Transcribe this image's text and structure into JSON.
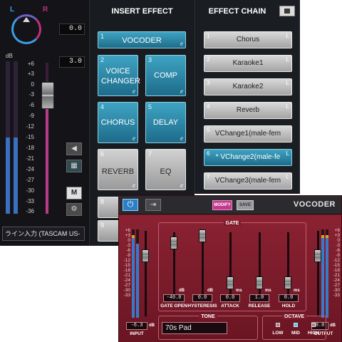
{
  "left": {
    "pan_left_label": "L",
    "pan_right_label": "R",
    "pan_value": "0.0",
    "fader_value": "3.0",
    "db_unit": "dB",
    "scale": [
      "+6",
      "+3",
      "0",
      "-3",
      "-6",
      "-9",
      "-12",
      "-15",
      "-18",
      "-21",
      "-24",
      "-27",
      "-30",
      "-33",
      "-36"
    ],
    "meter_left_level": 0.5,
    "meter_right_level": 0.5,
    "mute_button": "M",
    "input_name": "ライン入力 (TASCAM US-"
  },
  "insert_effect": {
    "title": "INSERT EFFECT",
    "slots": [
      {
        "num": "1",
        "label": "VOCODER",
        "edit": "e"
      },
      {
        "num": "2",
        "label": "VOICE CHANGER",
        "edit": "e"
      },
      {
        "num": "3",
        "label": "COMP",
        "edit": "e"
      },
      {
        "num": "4",
        "label": "CHORUS",
        "edit": "e"
      },
      {
        "num": "5",
        "label": "DELAY",
        "edit": "e"
      },
      {
        "num": "6",
        "label": "REVERB",
        "edit": "e"
      },
      {
        "num": "7",
        "label": "EQ",
        "edit": "e"
      },
      {
        "num": "8",
        "label": "",
        "edit": ""
      },
      {
        "num": "9",
        "label": "",
        "edit": ""
      }
    ]
  },
  "effect_chain": {
    "title": "EFFECT CHAIN",
    "items": [
      {
        "num": "1",
        "label": "Chorus",
        "flag": "L"
      },
      {
        "num": "2",
        "label": "Karaoke1",
        "flag": "L"
      },
      {
        "num": "3",
        "label": "Karaoke2",
        "flag": "L"
      },
      {
        "num": "4",
        "label": "Reverb",
        "flag": "L"
      },
      {
        "num": "5",
        "label": "VChange1(male-fem",
        "flag": ""
      },
      {
        "num": "6",
        "label": "* VChange2(male-fe",
        "flag": "L"
      },
      {
        "num": "7",
        "label": "VChange3(male-fem",
        "flag": "L"
      }
    ]
  },
  "vocoder": {
    "modify_label": "MODIFY",
    "save_label": "SAVE",
    "title": "VOCODER",
    "gate_title": "GATE",
    "scale": [
      "+6",
      "+3",
      "0",
      "-3",
      "-6",
      "-9",
      "-12",
      "-15",
      "-18",
      "-21",
      "-24",
      "-27",
      "-30",
      "-33"
    ],
    "input_value": "-6.3",
    "input_unit": "dB",
    "input_label": "INPUT",
    "output_value": "0.0",
    "output_unit": "dB",
    "output_label": "OUTPUT",
    "gate": {
      "gate_open": {
        "label": "GATE OPEN",
        "value": "-40.0",
        "unit": "dB"
      },
      "hysteresis": {
        "label": "HYSTERESIS",
        "value": "0.0",
        "unit": "dB"
      },
      "attack": {
        "label": "ATTACK",
        "value": "0.0",
        "unit": "ms"
      },
      "release": {
        "label": "RELEASE",
        "value": "1.0",
        "unit": "ms"
      },
      "hold": {
        "label": "HOLD",
        "value": "0.0",
        "unit": "ms"
      }
    },
    "tone_title": "TONE",
    "tone_value": "70s Pad",
    "octave_title": "OCTAVE",
    "octave_options": [
      "LOW",
      "MID",
      "HIGH"
    ],
    "octave_selected": "MID",
    "colors": {
      "accent": "#3fa3c3",
      "plugin_red": "#8b2233",
      "fader_pink": "#b83a8a"
    }
  }
}
